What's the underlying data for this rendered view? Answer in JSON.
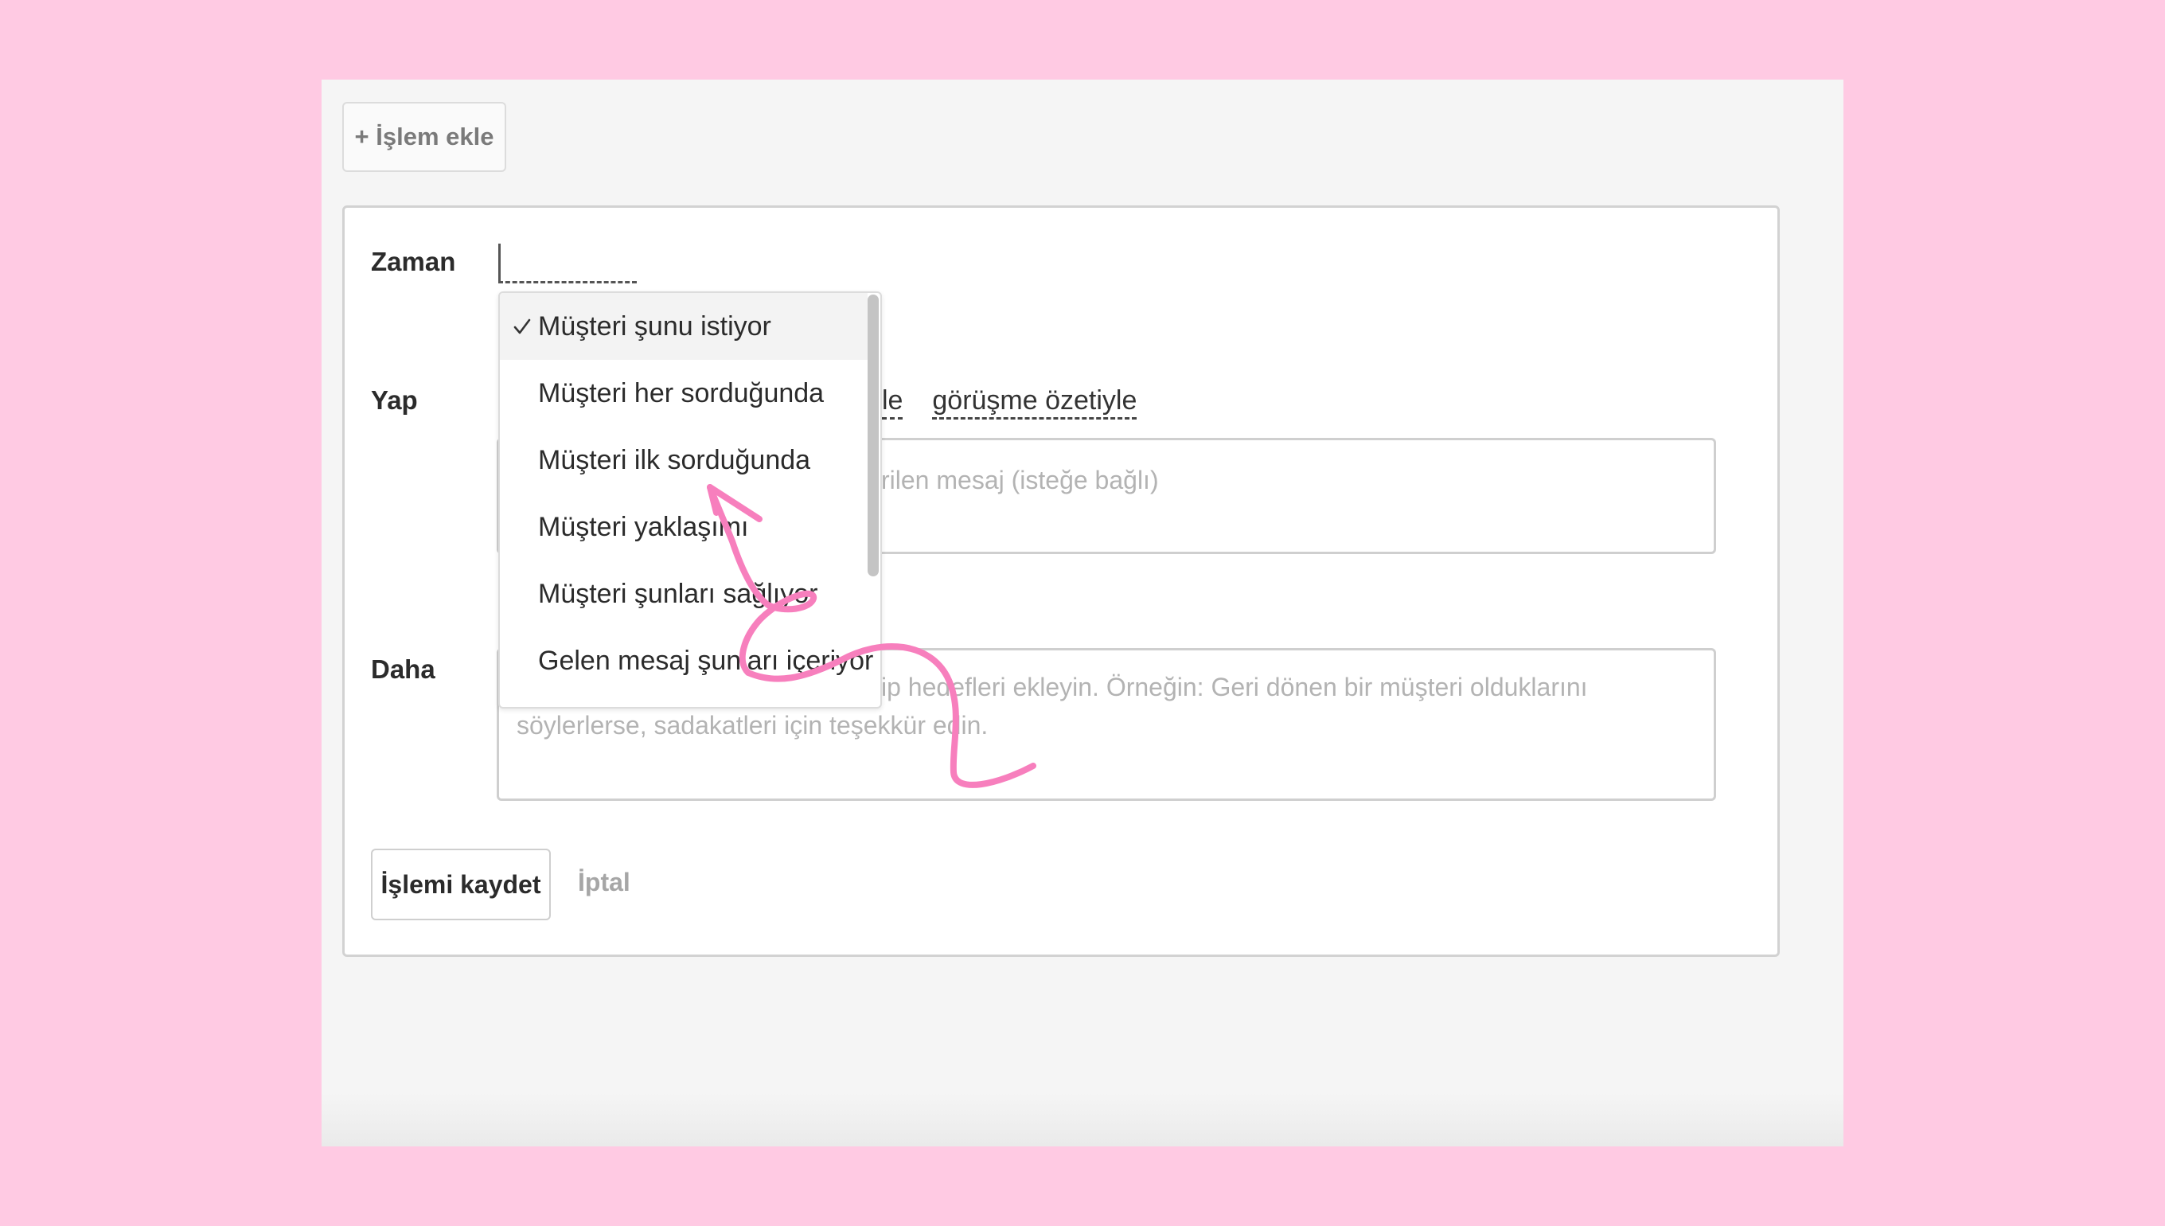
{
  "toolbar": {
    "add_action_label": "+ İşlem ekle"
  },
  "form": {
    "labels": {
      "zaman": "Zaman",
      "yap": "Yap",
      "daha": "Daha"
    },
    "yap_links": {
      "partial": "le",
      "summary": "görüşme özetiyle"
    },
    "message_placeholder_visible": "rilen mesaj (isteğe bağlı)",
    "more_placeholder_line1": "ip hedefleri ekleyin. Örneğin: Geri dönen bir müşteri olduklarını",
    "more_placeholder_line2": "söylerlerse, sadakatleri için teşekkür edin.",
    "save_label": "İşlemi kaydet",
    "cancel_label": "İptal"
  },
  "dropdown": {
    "items": [
      {
        "label": "Müşteri şunu istiyor",
        "selected": true
      },
      {
        "label": "Müşteri her sorduğunda",
        "selected": false
      },
      {
        "label": "Müşteri ilk sorduğunda",
        "selected": false
      },
      {
        "label": "Müşteri yaklaşımı",
        "selected": false
      },
      {
        "label": "Müşteri şunları sağlıyor",
        "selected": false
      },
      {
        "label": "Gelen mesaj şunları içeriyor",
        "selected": false
      }
    ]
  },
  "colors": {
    "background": "#ffcae3",
    "annotation_stroke": "#f77fbd"
  },
  "icons": {
    "check": "check-icon",
    "annotation": "pink-arrow-scribble"
  }
}
